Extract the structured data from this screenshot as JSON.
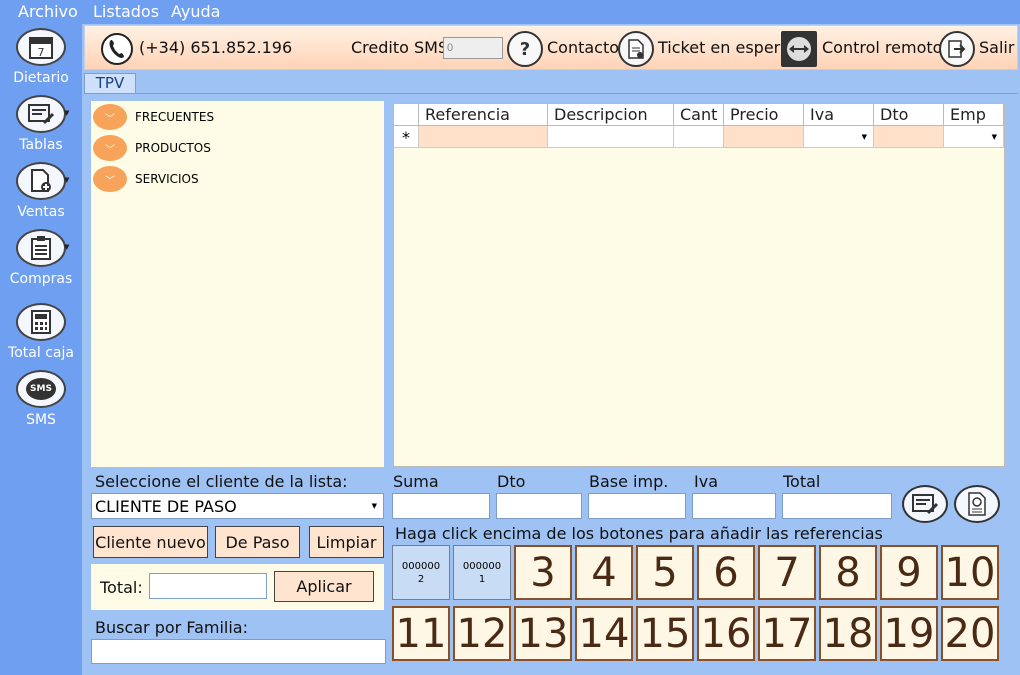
{
  "menu": {
    "archivo": "Archivo",
    "listados": "Listados",
    "ayuda": "Ayuda"
  },
  "sidebar": {
    "dietario": "Dietario",
    "dietario_day": "7",
    "tablas": "Tablas",
    "ventas": "Ventas",
    "compras": "Compras",
    "total_caja": "Total caja",
    "sms": "SMS",
    "sms_icon_text": "SMS"
  },
  "toolbar": {
    "phone": "(+34) 651.852.196",
    "credito_label": "Credito SMS",
    "credito_value": "0",
    "contacto": "Contacto",
    "ticket": "Ticket en espera",
    "control": "Control remoto",
    "salir": "Salir"
  },
  "tab": "TPV",
  "tree": [
    "FRECUENTES",
    "PRODUCTOS",
    "SERVICIOS"
  ],
  "grid": {
    "headers": [
      "Referencia",
      "Descripcion",
      "Cant",
      "Precio",
      "Iva",
      "Dto",
      "Emp"
    ],
    "new_row_marker": "*",
    "highlight": "#ffe0c8"
  },
  "cliente": {
    "label": "Seleccione el cliente de la lista:",
    "value": "CLIENTE DE PASO"
  },
  "buttons": {
    "nuevo": "Cliente nuevo",
    "depaso": "De Paso",
    "limpiar": "Limpiar",
    "aplicar": "Aplicar"
  },
  "total_label": "Total:",
  "buscar_label": "Buscar por Familia:",
  "totals": {
    "suma": "Suma",
    "dto": "Dto",
    "base": "Base imp.",
    "iva": "Iva",
    "total": "Total"
  },
  "hint": "Haga click encima de los botones para añadir las referencias",
  "refs": [
    {
      "top": "000000",
      "bottom": "2"
    },
    {
      "top": "000000",
      "bottom": "1"
    }
  ],
  "numbers": [
    "3",
    "4",
    "5",
    "6",
    "7",
    "8",
    "9",
    "10",
    "11",
    "12",
    "13",
    "14",
    "15",
    "16",
    "17",
    "18",
    "19",
    "20"
  ],
  "colors": {
    "accent": "#f7a35a",
    "panel": "#fefbe7",
    "background": "#6f9ff0"
  }
}
